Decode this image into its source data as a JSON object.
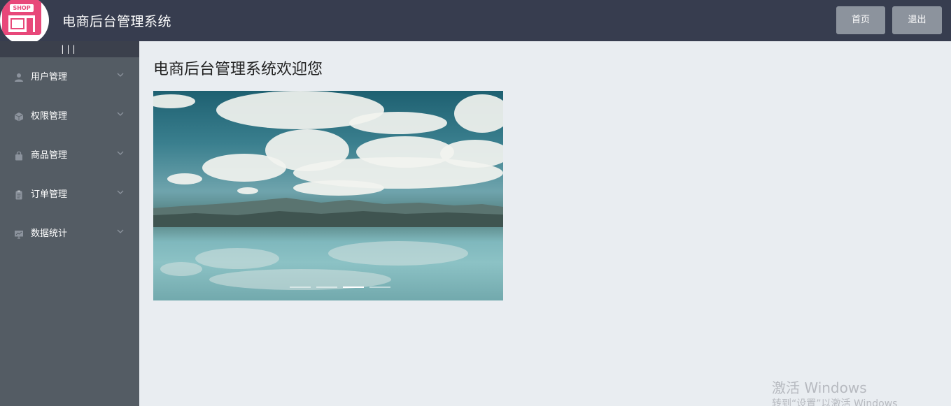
{
  "header": {
    "title": "电商后台管理系统",
    "logo_text": "SHOP",
    "home_label": "首页",
    "logout_label": "退出"
  },
  "sidebar": {
    "toggle_label": "|||",
    "items": [
      {
        "label": "用户管理",
        "icon": "user-icon"
      },
      {
        "label": "权限管理",
        "icon": "box-icon"
      },
      {
        "label": "商品管理",
        "icon": "bag-icon"
      },
      {
        "label": "订单管理",
        "icon": "document-icon"
      },
      {
        "label": "数据统计",
        "icon": "chart-icon"
      }
    ]
  },
  "main": {
    "welcome": "电商后台管理系统欢迎您",
    "carousel": {
      "slides": 4,
      "active_index": 2
    }
  },
  "watermark": {
    "line1": "激活 Windows",
    "line2": "转到“设置”以激活 Windows"
  },
  "colors": {
    "header_bg": "#373d4f",
    "sidebar_bg": "#545c64",
    "main_bg": "#e9edf1",
    "button_bg": "#8c939d",
    "logo_accent": "#e8487a"
  }
}
